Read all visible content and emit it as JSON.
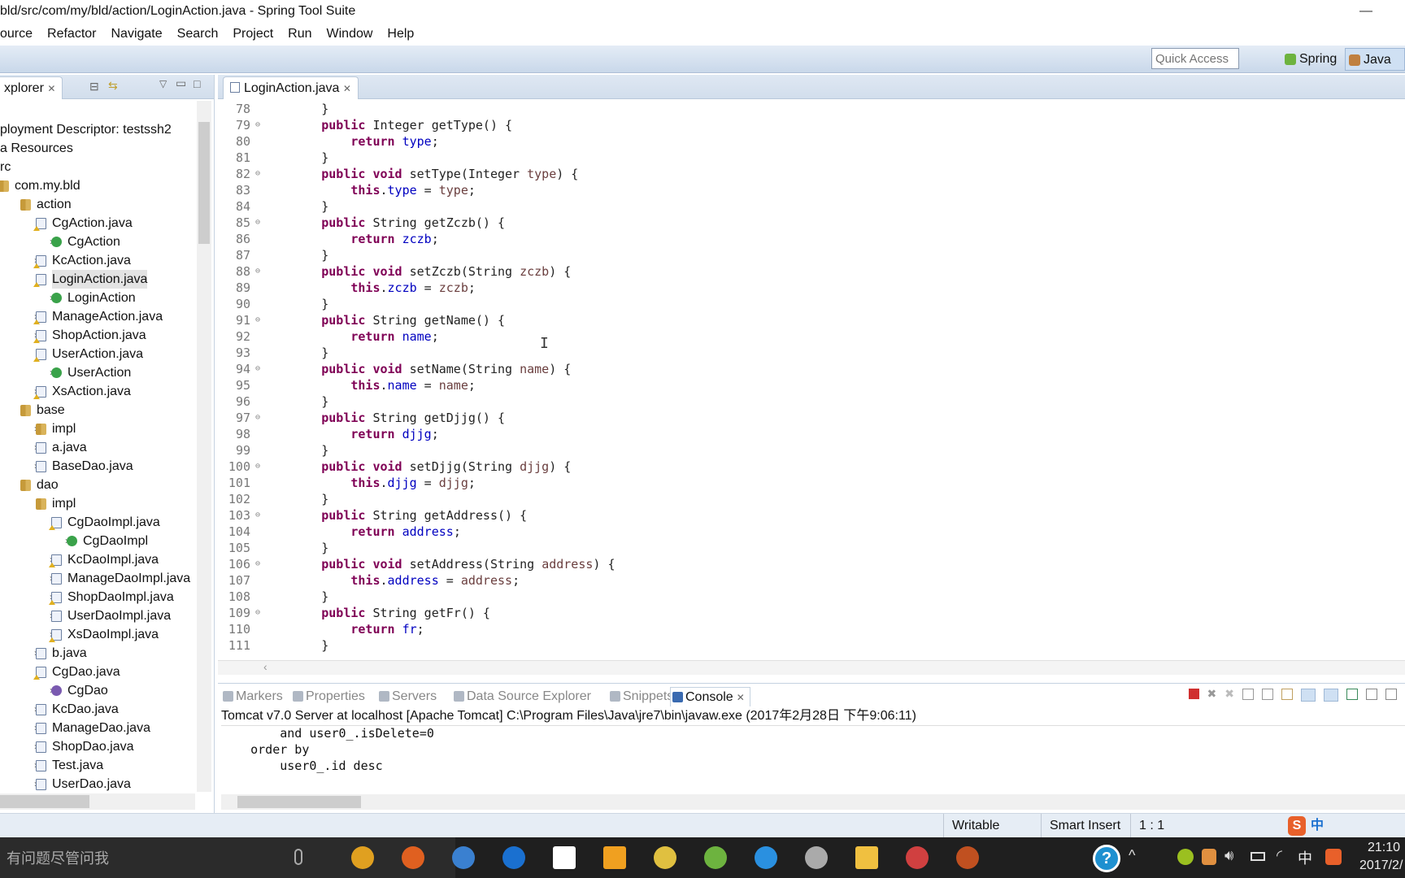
{
  "window": {
    "title": "bld/src/com/my/bld/action/LoginAction.java - Spring Tool Suite",
    "minimize": "—"
  },
  "menu": [
    "ource",
    "Refactor",
    "Navigate",
    "Search",
    "Project",
    "Run",
    "Window",
    "Help"
  ],
  "toolbar": {
    "quick_access_placeholder": "Quick Access",
    "perspectives": [
      {
        "label": "Spring",
        "icon": "spring-leaf-icon",
        "color": "#6db33f"
      },
      {
        "label": "Java EE",
        "icon": "java-ee-icon",
        "color": "#c08040"
      }
    ]
  },
  "explorer": {
    "tab_label": "xplorer",
    "items": [
      {
        "label": "ployment Descriptor: testssh2",
        "level": 0,
        "icon": "none",
        "twisty": ""
      },
      {
        "label": "a Resources",
        "level": 0,
        "icon": "none",
        "twisty": ""
      },
      {
        "label": "rc",
        "level": 0,
        "icon": "none",
        "twisty": ""
      },
      {
        "label": "com.my.bld",
        "level": 0,
        "icon": "package",
        "twisty": "",
        "indent": -1
      },
      {
        "label": "action",
        "level": 1,
        "icon": "package",
        "twisty": "v"
      },
      {
        "label": "CgAction.java",
        "level": 2,
        "icon": "file-warn",
        "twisty": "v"
      },
      {
        "label": "CgAction",
        "level": 3,
        "icon": "class",
        "twisty": ">"
      },
      {
        "label": "KcAction.java",
        "level": 2,
        "icon": "file-warn",
        "twisty": ">"
      },
      {
        "label": "LoginAction.java",
        "level": 2,
        "icon": "file-warn",
        "twisty": "v",
        "selected": true
      },
      {
        "label": "LoginAction",
        "level": 3,
        "icon": "class",
        "twisty": ">"
      },
      {
        "label": "ManageAction.java",
        "level": 2,
        "icon": "file-warn",
        "twisty": ">"
      },
      {
        "label": "ShopAction.java",
        "level": 2,
        "icon": "file-warn",
        "twisty": ">"
      },
      {
        "label": "UserAction.java",
        "level": 2,
        "icon": "file-warn",
        "twisty": "v"
      },
      {
        "label": "UserAction",
        "level": 3,
        "icon": "class",
        "twisty": ">"
      },
      {
        "label": "XsAction.java",
        "level": 2,
        "icon": "file-warn",
        "twisty": ">"
      },
      {
        "label": "base",
        "level": 1,
        "icon": "package",
        "twisty": "v"
      },
      {
        "label": "impl",
        "level": 2,
        "icon": "package",
        "twisty": ">"
      },
      {
        "label": "a.java",
        "level": 2,
        "icon": "file",
        "twisty": ">"
      },
      {
        "label": "BaseDao.java",
        "level": 2,
        "icon": "file",
        "twisty": ">"
      },
      {
        "label": "dao",
        "level": 1,
        "icon": "package",
        "twisty": "v"
      },
      {
        "label": "impl",
        "level": 2,
        "icon": "package",
        "twisty": "v"
      },
      {
        "label": "CgDaoImpl.java",
        "level": 3,
        "icon": "file-warn",
        "twisty": "v"
      },
      {
        "label": "CgDaoImpl",
        "level": 4,
        "icon": "class",
        "twisty": ">"
      },
      {
        "label": "KcDaoImpl.java",
        "level": 3,
        "icon": "file-warn",
        "twisty": ">"
      },
      {
        "label": "ManageDaoImpl.java",
        "level": 3,
        "icon": "file",
        "twisty": ">"
      },
      {
        "label": "ShopDaoImpl.java",
        "level": 3,
        "icon": "file-warn",
        "twisty": ">"
      },
      {
        "label": "UserDaoImpl.java",
        "level": 3,
        "icon": "file",
        "twisty": ">"
      },
      {
        "label": "XsDaoImpl.java",
        "level": 3,
        "icon": "file-warn",
        "twisty": ">"
      },
      {
        "label": "b.java",
        "level": 2,
        "icon": "file",
        "twisty": ">"
      },
      {
        "label": "CgDao.java",
        "level": 2,
        "icon": "file-warn",
        "twisty": "v"
      },
      {
        "label": "CgDao",
        "level": 3,
        "icon": "interface",
        "twisty": ">"
      },
      {
        "label": "KcDao.java",
        "level": 2,
        "icon": "file",
        "twisty": ">"
      },
      {
        "label": "ManageDao.java",
        "level": 2,
        "icon": "file",
        "twisty": ">"
      },
      {
        "label": "ShopDao.java",
        "level": 2,
        "icon": "file",
        "twisty": ">"
      },
      {
        "label": "Test.java",
        "level": 2,
        "icon": "file",
        "twisty": ">"
      },
      {
        "label": "UserDao.java",
        "level": 2,
        "icon": "file",
        "twisty": ">"
      }
    ]
  },
  "editor": {
    "tab_label": "LoginAction.java",
    "first_line": 78,
    "folded_lines": [
      79,
      82,
      85,
      88,
      91,
      94,
      97,
      100,
      103,
      106,
      109
    ],
    "lines": [
      "        }",
      "        public Integer getType() {",
      "            return type;",
      "        }",
      "        public void setType(Integer type) {",
      "            this.type = type;",
      "        }",
      "        public String getZczb() {",
      "            return zczb;",
      "        }",
      "        public void setZczb(String zczb) {",
      "            this.zczb = zczb;",
      "        }",
      "        public String getName() {",
      "            return name;",
      "        }",
      "        public void setName(String name) {",
      "            this.name = name;",
      "        }",
      "        public String getDjjg() {",
      "            return djjg;",
      "        }",
      "        public void setDjjg(String djjg) {",
      "            this.djjg = djjg;",
      "        }",
      "        public String getAddress() {",
      "            return address;",
      "        }",
      "        public void setAddress(String address) {",
      "            this.address = address;",
      "        }",
      "        public String getFr() {",
      "            return fr;",
      "        }"
    ]
  },
  "console": {
    "tabs": [
      "Markers",
      "Properties",
      "Servers",
      "Data Source Explorer",
      "Snippets",
      "Console"
    ],
    "active_tab": "Console",
    "info": "Tomcat v7.0 Server at localhost [Apache Tomcat] C:\\Program Files\\Java\\jre7\\bin\\javaw.exe (2017年2月28日 下午9:06:11)",
    "output": [
      "        and user0_.isDelete=0",
      "    order by",
      "        user0_.id desc"
    ]
  },
  "status": {
    "writable": "Writable",
    "insert_mode": "Smart Insert",
    "position": "1 : 1"
  },
  "taskbar": {
    "search_placeholder": "有问题尽管问我",
    "time": "21:10",
    "date": "2017/2/",
    "ime": "中",
    "apps": [
      {
        "name": "chrome",
        "color": "#e0a020"
      },
      {
        "name": "firefox",
        "color": "#e06020"
      },
      {
        "name": "sogou-browser",
        "color": "#3a80d0"
      },
      {
        "name": "edge",
        "color": "#1a70d0"
      },
      {
        "name": "store",
        "color": "#ffffff"
      },
      {
        "name": "notes",
        "color": "#f0a020"
      },
      {
        "name": "app-yellow",
        "color": "#e0c040"
      },
      {
        "name": "spring-tool-suite",
        "color": "#6db33f"
      },
      {
        "name": "wps",
        "color": "#2a90e0"
      },
      {
        "name": "settings",
        "color": "#aaaaaa"
      },
      {
        "name": "file-explorer",
        "color": "#f0c040"
      },
      {
        "name": "app-red",
        "color": "#d04040"
      },
      {
        "name": "app-face",
        "color": "#c05020"
      }
    ]
  }
}
